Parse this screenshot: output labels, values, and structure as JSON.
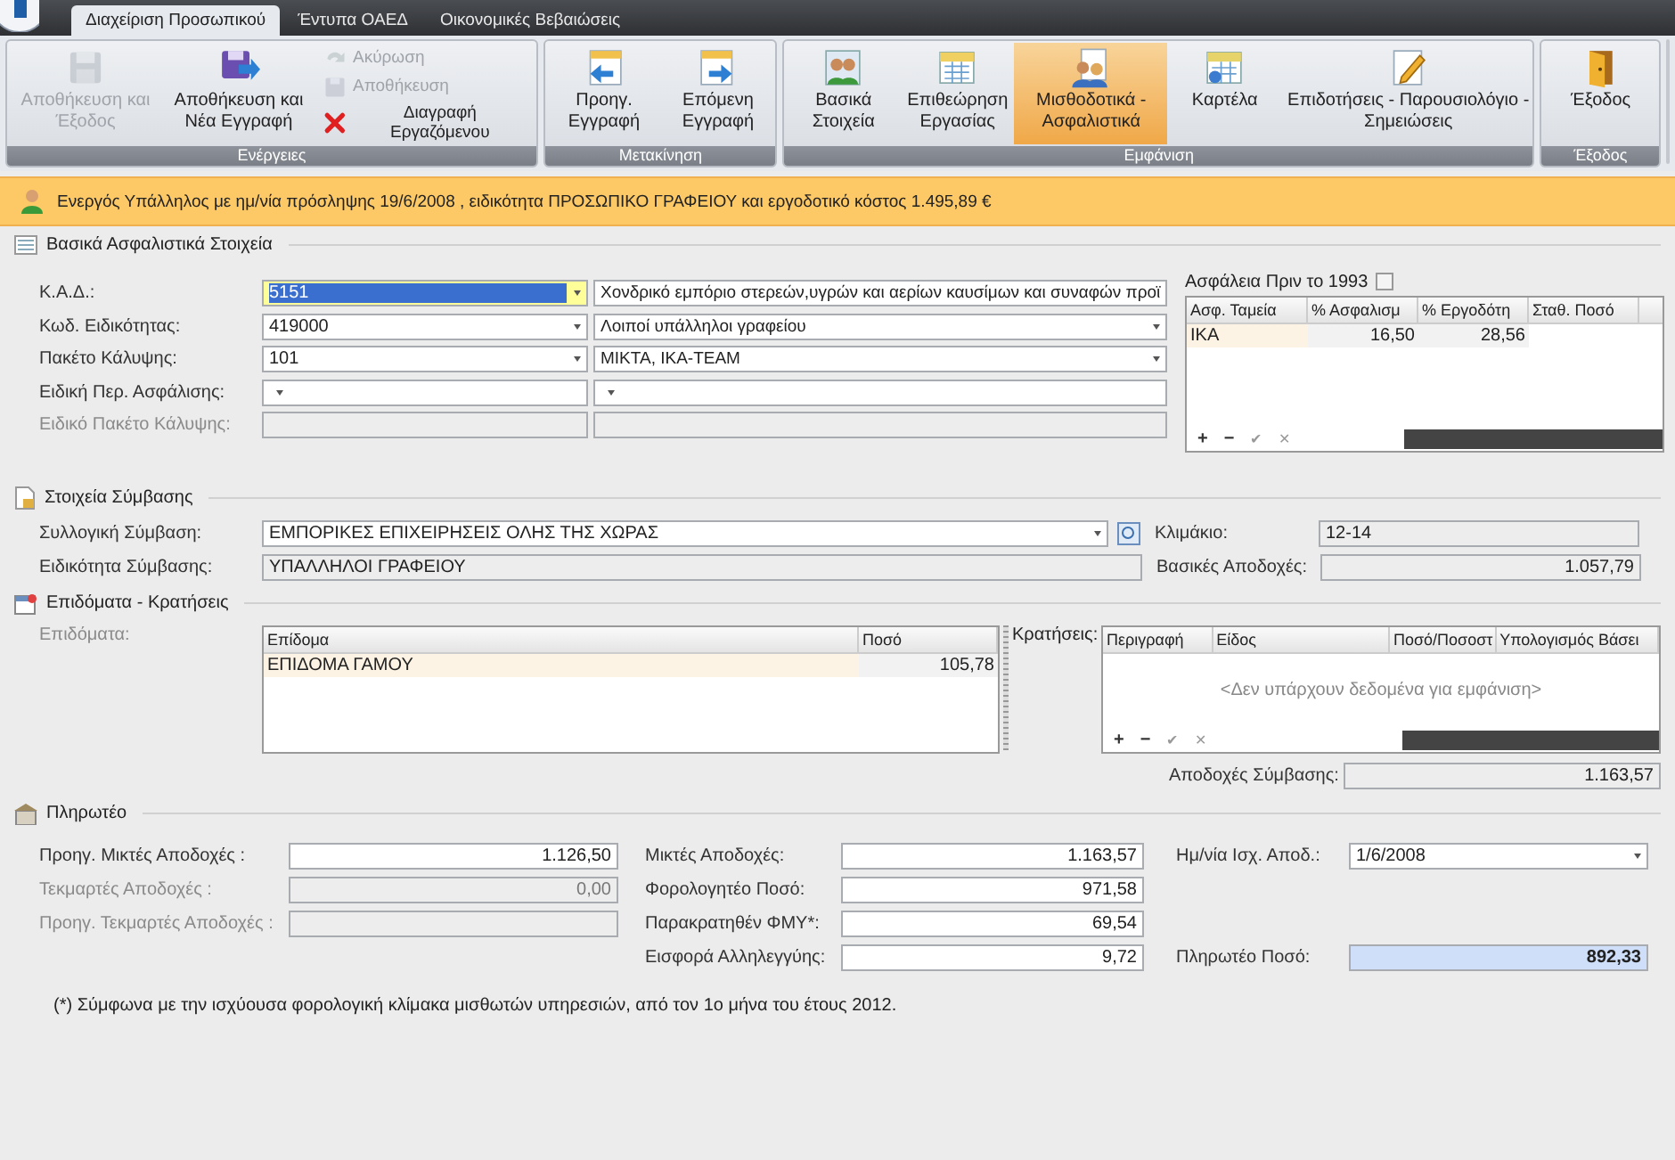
{
  "app_tabs": [
    {
      "label": "Διαχείριση Προσωπικού",
      "selected": true
    },
    {
      "label": "Έντυπα ΟΑΕΔ",
      "selected": false
    },
    {
      "label": "Οικονομικές Βεβαιώσεις",
      "selected": false
    }
  ],
  "ribbon": [
    {
      "title": "Ενέργειες",
      "buttons": [
        {
          "kind": "large",
          "label": "Αποθήκευση και Έξοδος",
          "disabled": true,
          "selected": false
        },
        {
          "kind": "large",
          "label": "Αποθήκευση και Νέα Εγγραφή",
          "disabled": false,
          "selected": false
        },
        {
          "kind": "small",
          "label": "Ακύρωση",
          "disabled": true,
          "selected": false
        },
        {
          "kind": "small",
          "label": "Αποθήκευση",
          "disabled": true,
          "selected": false
        },
        {
          "kind": "small",
          "label": "Διαγραφή Εργαζόμενου",
          "disabled": false,
          "selected": false
        }
      ]
    },
    {
      "title": "Μετακίνηση",
      "buttons": [
        {
          "kind": "large",
          "label": "Προηγ. Εγγραφή",
          "disabled": false,
          "selected": false
        },
        {
          "kind": "large",
          "label": "Επόμενη Εγγραφή",
          "disabled": false,
          "selected": false
        }
      ]
    },
    {
      "title": "Εμφάνιση",
      "buttons": [
        {
          "kind": "large",
          "label": "Βασικά Στοιχεία",
          "disabled": false,
          "selected": false
        },
        {
          "kind": "large",
          "label": "Επιθεώρηση Εργασίας",
          "disabled": false,
          "selected": false
        },
        {
          "kind": "large",
          "label": "Μισθοδοτικά - Ασφαλιστικά",
          "disabled": false,
          "selected": true
        },
        {
          "kind": "large",
          "label": "Καρτέλα",
          "disabled": false,
          "selected": false
        },
        {
          "kind": "large",
          "label": "Επιδοτήσεις - Παρουσιολόγιο - Σημειώσεις",
          "disabled": false,
          "selected": false
        }
      ]
    },
    {
      "title": "Έξοδος",
      "buttons": [
        {
          "kind": "large",
          "label": "Έξοδος",
          "disabled": false,
          "selected": false
        }
      ]
    }
  ],
  "info_bar": {
    "text": "Ενεργός Υπάλληλος με ημ/νία πρόσληψης 19/6/2008 , ειδικότητα ΠΡΟΣΩΠΙΚΟ ΓΡΑΦΕΙΟΥ και εργοδοτικό κόστος 1.495,89 €"
  },
  "insurance": {
    "title": "Βασικά Ασφαλιστικά Στοιχεία",
    "fields": [
      {
        "label": "Κ.Α.Δ.:",
        "code": "5151",
        "description": "Χονδρικό εμπόριο στερεών,υγρών και αερίων καυσίμων και συναφών προϊ",
        "focused": true,
        "disabled": false
      },
      {
        "label": "Κωδ. Ειδικότητας:",
        "code": "419000",
        "description": "Λοιποί υπάλληλοι γραφείου",
        "focused": false,
        "disabled": false
      },
      {
        "label": "Πακέτο Κάλυψης:",
        "code": "101",
        "description": "ΜΙΚΤΑ, ΙΚΑ-TEAM",
        "focused": false,
        "disabled": false
      },
      {
        "label": "Ειδική Περ. Ασφάλισης:",
        "focused": false,
        "disabled": false
      },
      {
        "label": "Ειδικό Πακέτο Κάλυψης:",
        "focused": false,
        "disabled": true
      }
    ],
    "pre_1993": {
      "label": "Ασφάλεια Πριν το 1993",
      "checked": false
    },
    "funds_table": {
      "columns": [
        "Ασφ. Ταμεία",
        "% Ασφαλισμ",
        "% Εργοδότη",
        "Σταθ. Ποσό"
      ],
      "rows": [
        {
          "fund": "ΙΚΑ",
          "insured": "16,50",
          "employer": "28,56"
        }
      ],
      "nav_buttons": [
        "+",
        "−",
        "✔",
        "✕"
      ]
    }
  },
  "contract": {
    "title": "Στοιχεία Σύμβασης",
    "agreement": {
      "label": "Συλλογική Σύμβαση:",
      "value": "ΕΜΠΟΡΙΚΕΣ ΕΠΙΧΕΙΡΗΣΕΙΣ ΟΛΗΣ ΤΗΣ ΧΩΡΑΣ"
    },
    "specialty": {
      "label": "Ειδικότητα Σύμβασης:",
      "value": "ΥΠΑΛΛΗΛΟΙ ΓΡΑΦΕΙΟΥ"
    },
    "scale": {
      "label": "Κλιμάκιο:",
      "value": "12-14"
    },
    "basic_pay": {
      "label": "Βασικές Αποδοχές:",
      "value": "1.057,79"
    }
  },
  "allowances": {
    "title": "Επιδόματα - Κρατήσεις",
    "allowances_label": "Επιδόματα:",
    "allowances_table": {
      "columns": [
        "Επίδομα",
        "Ποσό"
      ],
      "rows": [
        {
          "name": "ΕΠΙΔΟΜΑ ΓΑΜΟΥ",
          "amount": "105,78"
        }
      ]
    },
    "deductions_label": "Κρατήσεις:",
    "deductions_table": {
      "columns": [
        "Περιγραφή",
        "Είδος",
        "Ποσό/Ποσοστ",
        "Υπολογισμός Βάσει"
      ],
      "empty_text": "<Δεν υπάρχουν δεδομένα για εμφάνιση>",
      "nav_buttons": [
        "+",
        "−",
        "✔",
        "✕"
      ]
    },
    "contract_pay": {
      "label": "Αποδοχές Σύμβασης:",
      "value": "1.163,57"
    }
  },
  "payable": {
    "title": "Πληρωτέο",
    "column_1": [
      {
        "label": "Προηγ. Μικτές Αποδοχές :",
        "value": "1.126,50",
        "disabled": false
      },
      {
        "label": "Τεκμαρτές Αποδοχές :",
        "value": "0,00",
        "disabled": true
      },
      {
        "label": "Προηγ. Τεκμαρτές Αποδοχές :",
        "disabled": true
      }
    ],
    "column_2": [
      {
        "label": "Μικτές Αποδοχές:",
        "value": "1.163,57"
      },
      {
        "label": "Φορολογητέο Ποσό:",
        "value": "971,58"
      },
      {
        "label": "Παρακρατηθέν ΦΜΥ*:",
        "value": "69,54"
      },
      {
        "label": "Εισφορά Αλληλεγγύης:",
        "value": "9,72"
      }
    ],
    "column_3": [
      {
        "label": "Ημ/νία Ισχ. Αποδ.:",
        "value": "1/6/2008",
        "kind": "date",
        "emphasized": false
      },
      {
        "label": "Πληρωτέο Ποσό:",
        "value": "892,33",
        "kind": "amount",
        "emphasized": true
      }
    ],
    "footnote": "(*) Σύμφωνα με την ισχύουσα φορολογική κλίμακα μισθωτών υπηρεσιών, από τον 1ο μήνα του έτους 2012."
  }
}
